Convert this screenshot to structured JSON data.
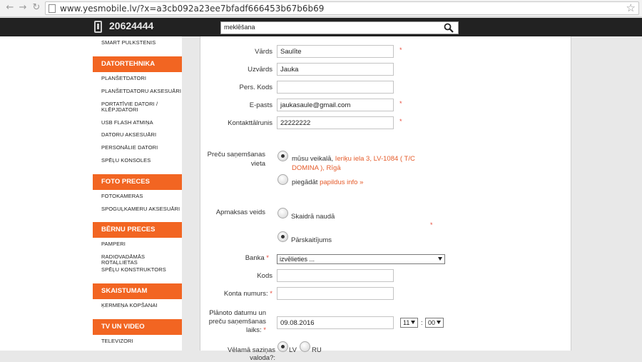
{
  "browser": {
    "url": "www.yesmobile.lv/?x=a3cb092a23ee7bfadf666453b67b6b69"
  },
  "header": {
    "phone": "20624444",
    "search_value": "meklēšana"
  },
  "sidebar": {
    "top_item": "SMART PULKSTENIS",
    "sections": [
      {
        "title": "DATORTEHNIKA",
        "items": [
          "PLANŠETDATORI",
          "PLANŠETDATORU AKSESUĀRI",
          "PORTATĪVIE DATORI /",
          "KLĒPJDATORI",
          "USB FLASH ATMIŅA",
          "DATORU AKSESUĀRI",
          "PERSONĀLIE DATORI",
          "SPĒĻU KONSOLES"
        ]
      },
      {
        "title": "FOTO PRECES",
        "items": [
          "FOTOKAMERAS",
          "SPOGUĻKAMERU AKSESUĀRI"
        ]
      },
      {
        "title": "BĒRNU PRECES",
        "items": [
          "PAMPERI",
          "RADIOVADĀMĀS ROTAĻLIETAS",
          "SPĒĻU KONSTRUKTORS"
        ]
      },
      {
        "title": "SKAISTUMAM",
        "items": [
          "ĶERMEŅA KOPŠANAI"
        ]
      },
      {
        "title": "TV UN VIDEO",
        "items": [
          "TELEVIZORI"
        ]
      }
    ]
  },
  "form": {
    "required_mark": "*",
    "vards": {
      "label": "Vārds",
      "value": "Saulīte"
    },
    "uzvards": {
      "label": "Uzvārds",
      "value": "Jauka"
    },
    "pers_kods": {
      "label": "Pers. Kods",
      "value": ""
    },
    "epasts": {
      "label": "E-pasts",
      "value": "jaukasaule@gmail.com"
    },
    "talrunis": {
      "label": "Kontakttālrunis",
      "value": "22222222"
    },
    "vieta": {
      "label_line1": "Preču saņemšanas",
      "label_line2": "vieta",
      "opt1_prefix": "mūsu veikalā,",
      "opt1_address_line1": "Ieriķu iela 3, LV-1084 ( T/C",
      "opt1_address_line2": "DOMINA ), Rīgā",
      "opt2_prefix": "piegādāt",
      "opt2_link": "papildus info »"
    },
    "apmaksa": {
      "label": "Apmaksas veids",
      "opt1": "Skaidrā naudā",
      "opt2": "Pārskaitījums"
    },
    "banka": {
      "label": "Banka",
      "value": "izvēlieties ..."
    },
    "kods": {
      "label": "Kods",
      "value": ""
    },
    "konta_numurs": {
      "label": "Konta numurs:",
      "value": ""
    },
    "datums": {
      "label_line1": "Plānoto datumu un",
      "label_line2": "preču saņemšanas",
      "label_line3": "laiks:",
      "date": "09.08.2016",
      "hour": "11",
      "separator": ":",
      "minute": "00"
    },
    "valoda": {
      "label": "Vēlamā saziņas valoda?:",
      "opt1": "LV",
      "opt2": "RU"
    }
  }
}
